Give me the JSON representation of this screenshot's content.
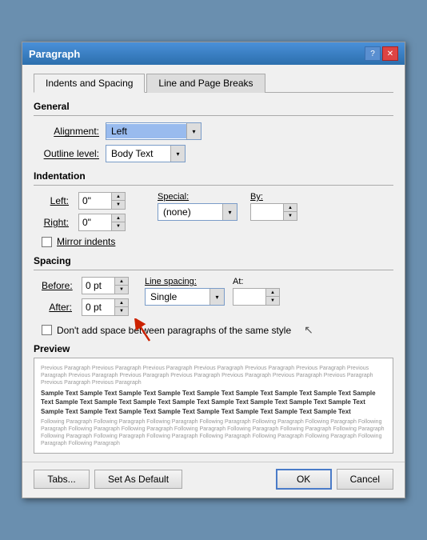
{
  "dialog": {
    "title": "Paragraph",
    "tabs": [
      {
        "label": "Indents and Spacing",
        "active": true
      },
      {
        "label": "Line and Page Breaks",
        "active": false
      }
    ]
  },
  "general": {
    "section_label": "General",
    "alignment_label": "Alignment:",
    "alignment_value": "Left",
    "outline_level_label": "Outline level:",
    "outline_level_value": "Body Text"
  },
  "indentation": {
    "section_label": "Indentation",
    "left_label": "Left:",
    "left_value": "0\"",
    "right_label": "Right:",
    "right_value": "0\"",
    "special_label": "Special:",
    "special_value": "(none)",
    "by_label": "By:",
    "by_value": "",
    "mirror_label": "Mirror indents"
  },
  "spacing": {
    "section_label": "Spacing",
    "before_label": "Before:",
    "before_value": "0 pt",
    "after_label": "After:",
    "after_value": "0 pt",
    "line_spacing_label": "Line spacing:",
    "line_spacing_value": "Single",
    "at_label": "At:",
    "at_value": "",
    "dont_add_label": "Don't add space between paragraphs of the same style"
  },
  "preview": {
    "section_label": "Preview",
    "gray_text": "Previous Paragraph Previous Paragraph Previous Paragraph Previous Paragraph Previous Paragraph Previous Paragraph Previous Paragraph Previous Paragraph Previous Paragraph Previous Paragraph Previous Paragraph Previous Paragraph Previous Paragraph Previous Paragraph Previous Paragraph",
    "sample_text": "Sample Text Sample Text Sample Text Sample Text Sample Text Sample Text Sample Text Sample Text Sample Text Sample Text Sample Text Sample Text Sample Text Sample Text Sample Text Sample Text Sample Text Sample Text Sample Text Sample Text Sample Text Sample Text Sample Text Sample Text Sample Text",
    "following_text": "Following Paragraph Following Paragraph Following Paragraph Following Paragraph Following Paragraph Following Paragraph Following Paragraph Following Paragraph Following Paragraph Following Paragraph Following Paragraph Following Paragraph Following Paragraph Following Paragraph Following Paragraph Following Paragraph Following Paragraph Following Paragraph Following Paragraph Following Paragraph Following Paragraph"
  },
  "footer": {
    "tabs_label": "Tabs...",
    "set_default_label": "Set As Default",
    "ok_label": "OK",
    "cancel_label": "Cancel"
  }
}
